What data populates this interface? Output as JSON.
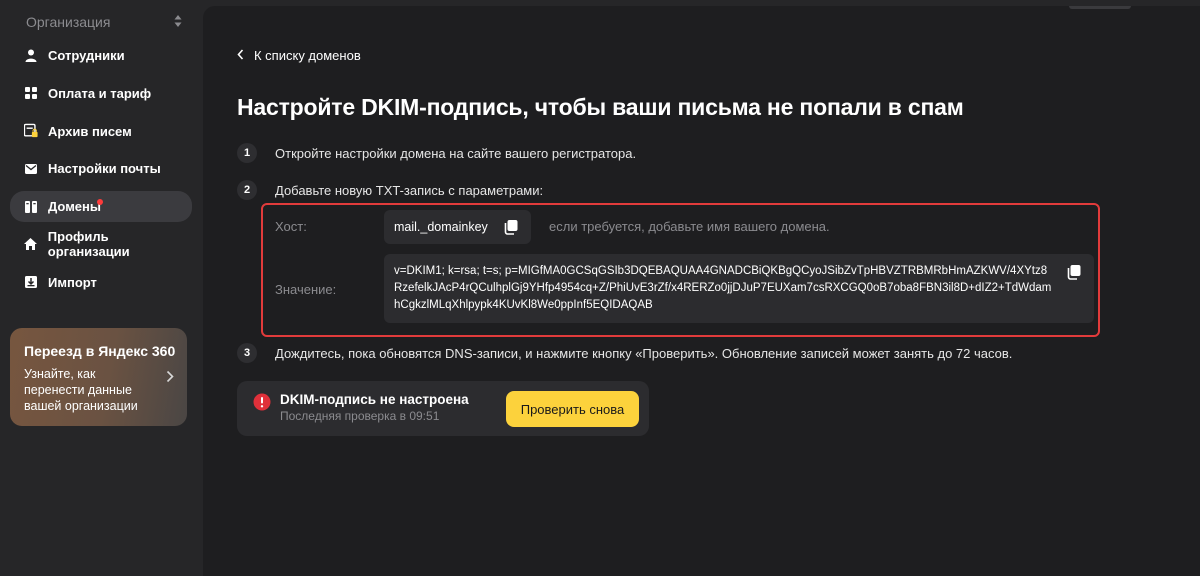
{
  "sidebar": {
    "org_label": "Организация",
    "items": [
      {
        "label": "Сотрудники",
        "icon": "person-icon"
      },
      {
        "label": "Оплата и тариф",
        "icon": "grid-icon"
      },
      {
        "label": "Архив писем",
        "icon": "archive-lock-icon"
      },
      {
        "label": "Настройки почты",
        "icon": "envelope-icon"
      },
      {
        "label": "Домены",
        "icon": "domains-icon",
        "active": true,
        "has_dot": true
      },
      {
        "label": "Профиль организации",
        "icon": "home-icon"
      },
      {
        "label": "Импорт",
        "icon": "import-icon"
      }
    ],
    "promo": {
      "title": "Переезд в Яндекс 360",
      "text": "Узнайте, как перенести данные вашей организации"
    }
  },
  "main": {
    "back_link": "К списку доменов",
    "title": "Настройте DKIM-подпись, чтобы ваши письма не попали в спам",
    "steps": [
      {
        "num": "1",
        "text": "Откройте настройки домена на сайте вашего регистратора."
      },
      {
        "num": "2",
        "text": "Добавьте новую TXT-запись с параметрами:"
      },
      {
        "num": "3",
        "text": "Дождитесь, пока обновятся DNS-записи, и нажмите кнопку «Проверить». Обновление записей может занять до 72 часов."
      }
    ],
    "params": {
      "host_label": "Хост:",
      "host_value": "mail._domainkey",
      "host_hint": "если требуется, добавьте имя вашего домена.",
      "value_label": "Значение:",
      "value": "v=DKIM1; k=rsa; t=s; p=MIGfMA0GCSqGSIb3DQEBAQUAA4GNADCBiQKBgQCyoJSibZvTpHBVZTRBMRbHmAZKWV/4XYtz8RzefelkJAcP4rQCulhplGj9YHfp4954cq+Z/PhiUvE3rZf/x4RERZo0jjDJuP7EUXam7csRXCGQ0oB7oba8FBN3il8D+dIZ2+TdWdamhCgkzlMLqXhlpypk4KUvKl8We0ppInf5EQIDAQAB"
    },
    "status": {
      "title": "DKIM-подпись не настроена",
      "subtitle": "Последняя проверка в 09:51",
      "button": "Проверить снова"
    }
  },
  "colors": {
    "background": "#1e1e20",
    "sidebar": "#262628",
    "accent_button": "#fcd23c",
    "highlight_border": "#e23b3b",
    "error_icon": "#e0303a"
  }
}
